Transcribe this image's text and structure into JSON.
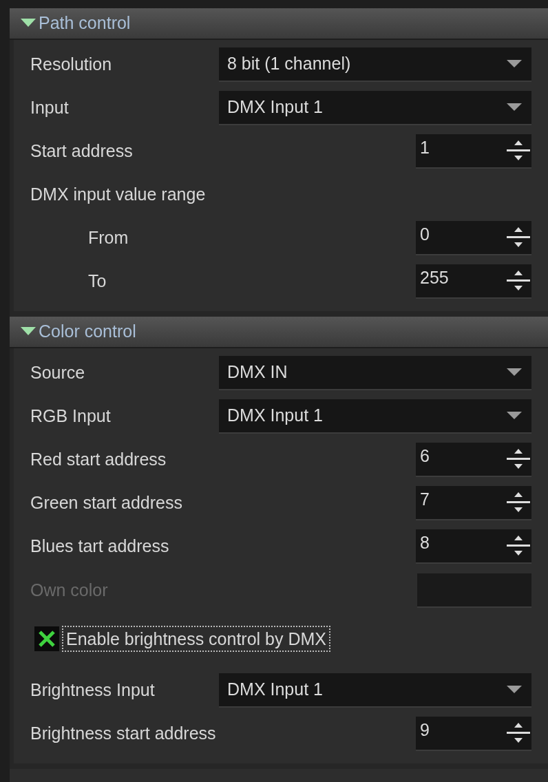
{
  "sections": [
    {
      "title": "Path control",
      "expanded": true,
      "rows": [
        {
          "kind": "dropdown",
          "label": "Resolution",
          "value": "8 bit (1 channel)",
          "disabled": false
        },
        {
          "kind": "dropdown",
          "label": "Input",
          "value": "DMX Input 1",
          "disabled": false
        },
        {
          "kind": "spin",
          "label": "Start address",
          "value": "1",
          "disabled": false
        },
        {
          "kind": "heading",
          "label": "DMX input value range",
          "disabled": false
        },
        {
          "kind": "spin",
          "label": "From",
          "value": "0",
          "indented": true,
          "disabled": false
        },
        {
          "kind": "spin",
          "label": "To",
          "value": "255",
          "indented": true,
          "disabled": false
        }
      ]
    },
    {
      "title": "Color control",
      "expanded": true,
      "rows": [
        {
          "kind": "dropdown",
          "label": "Source",
          "value": "DMX IN",
          "disabled": false
        },
        {
          "kind": "dropdown",
          "label": "RGB Input",
          "value": "DMX Input 1",
          "disabled": false
        },
        {
          "kind": "spin",
          "label": "Red start address",
          "value": "6",
          "disabled": false
        },
        {
          "kind": "spin",
          "label": "Green start address",
          "value": "7",
          "disabled": false
        },
        {
          "kind": "spin",
          "label": "Blues tart address",
          "value": "8",
          "disabled": false
        },
        {
          "kind": "color",
          "label": "Own color",
          "disabled": true
        },
        {
          "kind": "checkbox",
          "label": "Enable brightness control by DMX",
          "checked": true,
          "disabled": false
        },
        {
          "kind": "dropdown",
          "label": "Brightness Input",
          "value": "DMX Input 1",
          "disabled": false
        },
        {
          "kind": "spin",
          "label": "Brightness start address",
          "value": "9",
          "disabled": false
        }
      ]
    }
  ]
}
